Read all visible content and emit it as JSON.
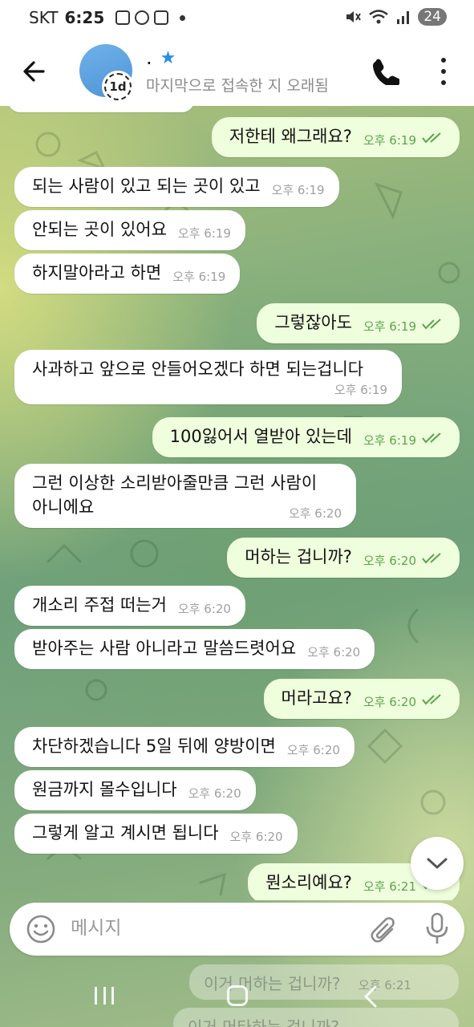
{
  "status_bar": {
    "carrier": "SKT",
    "time": "6:25",
    "battery": "24"
  },
  "header": {
    "name": ".",
    "status": "마지막으로 접속한 지 오래됨",
    "avatar_badge": "1d",
    "avatar_color": "#5aa0e2"
  },
  "messages": [
    {
      "dir": "out",
      "text": "저한테 왜그래요?",
      "time": "오후 6:19"
    },
    {
      "dir": "in",
      "text": "되는 사람이 있고 되는 곳이 있고",
      "time": "오후 6:19"
    },
    {
      "dir": "in",
      "text": "안되는 곳이 있어요",
      "time": "오후 6:19"
    },
    {
      "dir": "in",
      "text": "하지말아라고 하면",
      "time": "오후 6:19"
    },
    {
      "dir": "out",
      "text": "그렇잖아도",
      "time": "오후 6:19"
    },
    {
      "dir": "in",
      "text": "사과하고 앞으로 안들어오겠다 하면 되는겁니다",
      "time": "오후 6:19"
    },
    {
      "dir": "out",
      "text": "100잃어서 열받아 있는데",
      "time": "오후 6:19"
    },
    {
      "dir": "in",
      "line1": "그런 이상한 소리받아줄만큼 그런 사람이",
      "line2": "아니에요",
      "time": "오후 6:20"
    },
    {
      "dir": "out",
      "text": "머하는 겁니까?",
      "time": "오후 6:20"
    },
    {
      "dir": "in",
      "text": "개소리 주접 떠는거",
      "time": "오후 6:20"
    },
    {
      "dir": "in",
      "text": "받아주는 사람 아니라고 말씀드렷어요",
      "time": "오후 6:20"
    },
    {
      "dir": "out",
      "text": "머라고요?",
      "time": "오후 6:20"
    },
    {
      "dir": "in",
      "text": "차단하겠습니다 5일 뒤에 양방이면",
      "time": "오후 6:20"
    },
    {
      "dir": "in",
      "text": "원금까지 몰수입니다",
      "time": "오후 6:20"
    },
    {
      "dir": "in",
      "text": "그렇게 알고 계시면 됩니다",
      "time": "오후 6:20"
    },
    {
      "dir": "out",
      "text": "뭔소리예요?",
      "time": "오후 6:21"
    }
  ],
  "ghost_messages": [
    {
      "text": "이거 머하는 겁니까?",
      "time": "오후 6:21"
    },
    {
      "text": "이거 머타하는 겁니까?"
    }
  ],
  "input": {
    "placeholder": "메시지"
  },
  "colors": {
    "outgoing_bubble": "#effedd",
    "incoming_bubble": "#ffffff",
    "read_ticks": "#5aa54a",
    "accent": "#2b8ce8"
  }
}
